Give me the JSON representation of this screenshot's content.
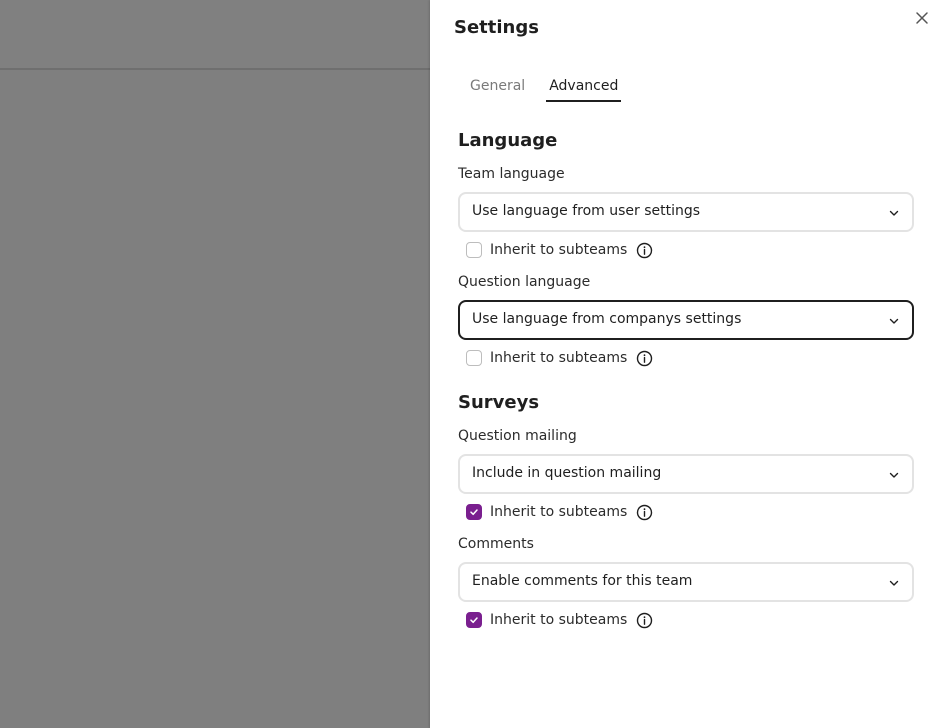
{
  "panel": {
    "title": "Settings"
  },
  "tabs": [
    {
      "label": "General",
      "active": false
    },
    {
      "label": "Advanced",
      "active": true
    }
  ],
  "language": {
    "title": "Language",
    "team_language": {
      "label": "Team language",
      "value": "Use language from user settings",
      "inherit_label": "Inherit to subteams",
      "inherit_checked": false
    },
    "question_language": {
      "label": "Question language",
      "value": "Use language from companys settings",
      "inherit_label": "Inherit to subteams",
      "inherit_checked": false
    }
  },
  "surveys": {
    "title": "Surveys",
    "question_mailing": {
      "label": "Question mailing",
      "value": "Include in question mailing",
      "inherit_label": "Inherit to subteams",
      "inherit_checked": true
    },
    "comments": {
      "label": "Comments",
      "value": "Enable comments for this team",
      "inherit_label": "Inherit to subteams",
      "inherit_checked": true
    }
  },
  "icons": {
    "close": "close-icon",
    "chevron": "chevron-down-icon",
    "info": "info-icon",
    "check": "checkmark-icon"
  },
  "colors": {
    "accent": "#7a1f8f",
    "backdrop": "#7f7f7f",
    "focus_border": "#1f1f1f"
  }
}
